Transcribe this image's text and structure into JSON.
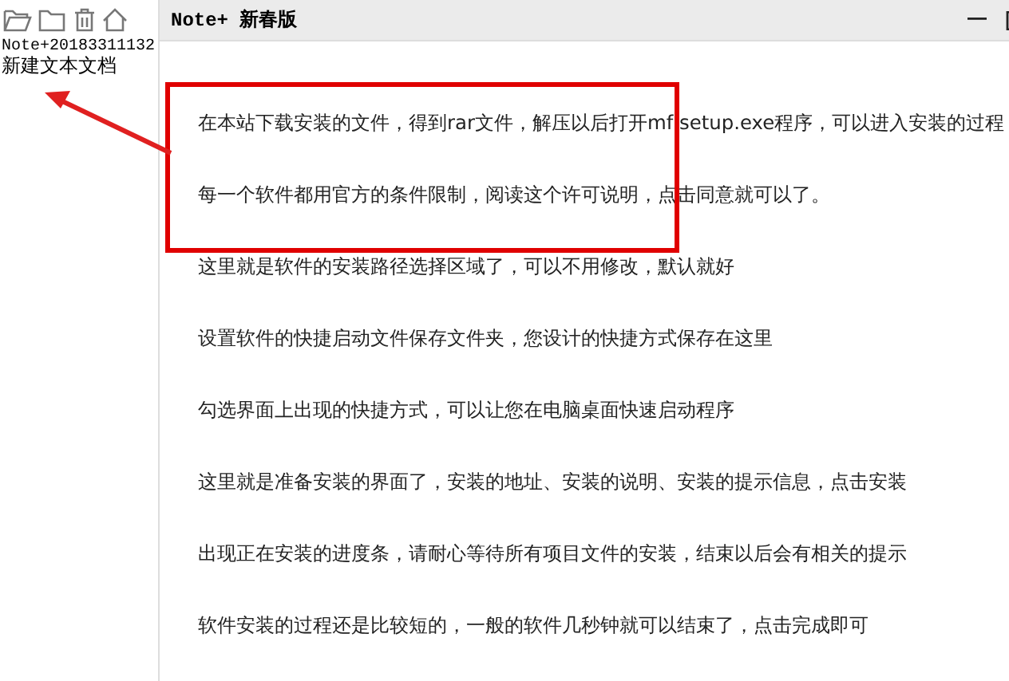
{
  "window": {
    "title": "Note+ 新春版"
  },
  "sidebar": {
    "items": [
      {
        "label": "Note+20183311132"
      },
      {
        "label": "新建文本文档"
      }
    ]
  },
  "document": {
    "paragraphs": [
      "在本站下载安装的文件，得到rar文件，解压以后打开mf setup.exe程序，可以进入安装的过程",
      "每一个软件都用官方的条件限制，阅读这个许可说明，点击同意就可以了。",
      "这里就是软件的安装路径选择区域了，可以不用修改，默认就好",
      "设置软件的快捷启动文件保存文件夹，您设计的快捷方式保存在这里",
      "勾选界面上出现的快捷方式，可以让您在电脑桌面快速启动程序",
      "这里就是准备安装的界面了，安装的地址、安装的说明、安装的提示信息，点击安装",
      "出现正在安装的进度条，请耐心等待所有项目文件的安装，结束以后会有相关的提示",
      "软件安装的过程还是比较短的，一般的软件几秒钟就可以结束了，点击完成即可"
    ]
  }
}
